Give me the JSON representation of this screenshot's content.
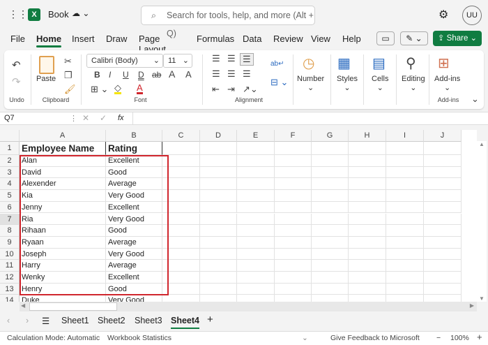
{
  "app": {
    "file_name": "Book",
    "search_placeholder": "Search for tools, help, and more (Alt + Q)",
    "user_initials": "UU"
  },
  "tabs": [
    "File",
    "Home",
    "Insert",
    "Draw",
    "Page Layout",
    "Formulas",
    "Data",
    "Review",
    "View",
    "Help"
  ],
  "active_tab": "Home",
  "share_label": "Share",
  "ribbon": {
    "undo_group": "Undo",
    "paste": "Paste",
    "clipboard_group": "Clipboard",
    "font_name": "Calibri (Body)",
    "font_size": "11",
    "font_group": "Font",
    "alignment_group": "Alignment",
    "number": "Number",
    "styles": "Styles",
    "cells": "Cells",
    "editing": "Editing",
    "addins": "Add-ins",
    "addins_group": "Add-ins",
    "font_buttons": [
      "B",
      "I",
      "U",
      "D",
      "ab",
      "A",
      "A"
    ]
  },
  "formula_bar": {
    "name_box": "Q7",
    "fx": "fx",
    "value": ""
  },
  "columns": [
    "A",
    "B",
    "C",
    "D",
    "E",
    "F",
    "G",
    "H",
    "I",
    "J"
  ],
  "rows": [
    [
      "Employee Name",
      "Rating"
    ],
    [
      "Alan",
      "Excellent"
    ],
    [
      "David",
      "Good"
    ],
    [
      "Alexender",
      "Average"
    ],
    [
      "Kia",
      "Very Good"
    ],
    [
      "Jenny",
      "Excellent"
    ],
    [
      "Ria",
      "Very Good"
    ],
    [
      "Rihaan",
      "Good"
    ],
    [
      "Ryaan",
      "Average"
    ],
    [
      "Joseph",
      "Very Good"
    ],
    [
      "Harry",
      "Average"
    ],
    [
      "Wenky",
      "Excellent"
    ],
    [
      "Henry",
      "Good"
    ],
    [
      "Duke",
      "Very Good"
    ]
  ],
  "selected_row": 7,
  "sheets": [
    "Sheet1",
    "Sheet2",
    "Sheet3",
    "Sheet4"
  ],
  "active_sheet": "Sheet4",
  "status": {
    "calc_mode": "Calculation Mode: Automatic",
    "workbook_stats": "Workbook Statistics",
    "feedback": "Give Feedback to Microsoft",
    "zoom": "100%"
  },
  "colors": {
    "accent": "#107c41",
    "highlight_border": "#d0262d"
  }
}
